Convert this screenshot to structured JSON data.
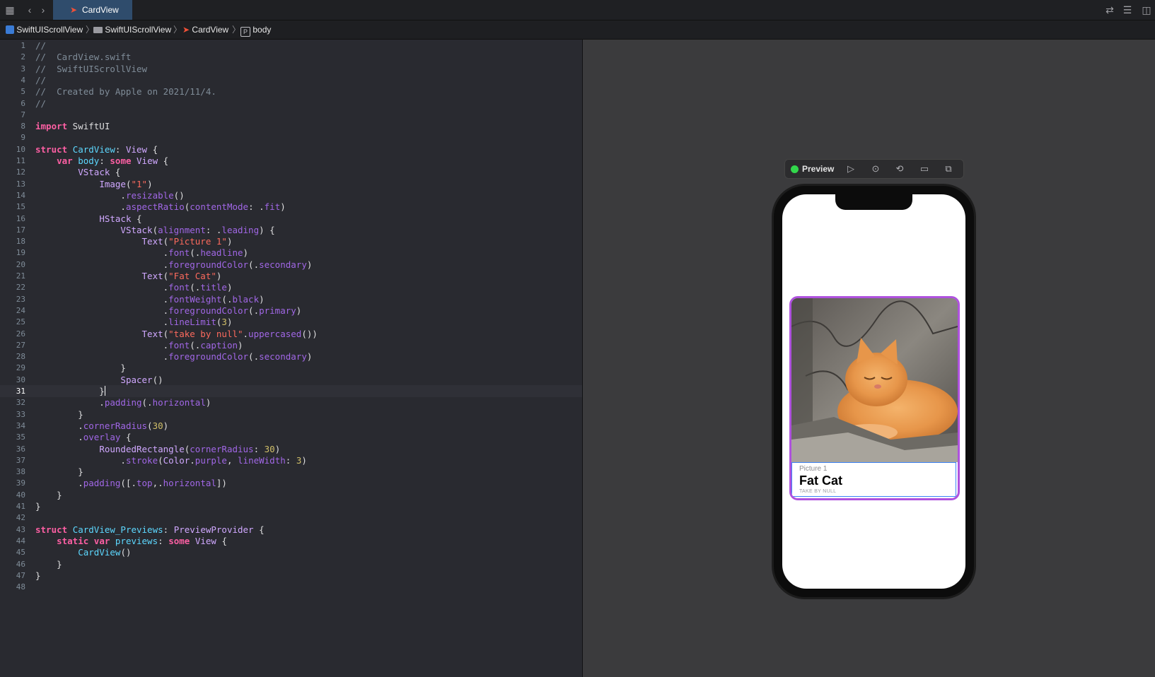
{
  "tab": {
    "title": "CardView"
  },
  "breadcrumb": {
    "project": "SwiftUIScrollView",
    "folder": "SwiftUIScrollView",
    "file": "CardView",
    "symbol": "body",
    "symbol_badge": "P"
  },
  "editor": {
    "current_line": 31,
    "lines": [
      {
        "n": "1",
        "t": [
          [
            "c-cmt",
            "//"
          ]
        ]
      },
      {
        "n": "2",
        "t": [
          [
            "c-cmt",
            "//  CardView.swift"
          ]
        ]
      },
      {
        "n": "3",
        "t": [
          [
            "c-cmt",
            "//  SwiftUIScrollView"
          ]
        ]
      },
      {
        "n": "4",
        "t": [
          [
            "c-cmt",
            "//"
          ]
        ]
      },
      {
        "n": "5",
        "t": [
          [
            "c-cmt",
            "//  Created by Apple on 2021/11/4."
          ]
        ]
      },
      {
        "n": "6",
        "t": [
          [
            "c-cmt",
            "//"
          ]
        ]
      },
      {
        "n": "7",
        "t": []
      },
      {
        "n": "8",
        "t": [
          [
            "c-kw",
            "import"
          ],
          [
            "c-plain",
            " SwiftUI"
          ]
        ]
      },
      {
        "n": "9",
        "t": []
      },
      {
        "n": "10",
        "t": [
          [
            "c-kw",
            "struct"
          ],
          [
            "c-plain",
            " "
          ],
          [
            "c-decl",
            "CardView"
          ],
          [
            "c-plain",
            ": "
          ],
          [
            "c-type",
            "View"
          ],
          [
            "c-plain",
            " {"
          ]
        ]
      },
      {
        "n": "11",
        "t": [
          [
            "c-plain",
            "    "
          ],
          [
            "c-kw",
            "var"
          ],
          [
            "c-plain",
            " "
          ],
          [
            "c-decl",
            "body"
          ],
          [
            "c-plain",
            ": "
          ],
          [
            "c-kw",
            "some"
          ],
          [
            "c-plain",
            " "
          ],
          [
            "c-type",
            "View"
          ],
          [
            "c-plain",
            " {"
          ]
        ]
      },
      {
        "n": "12",
        "t": [
          [
            "c-plain",
            "        "
          ],
          [
            "c-type",
            "VStack"
          ],
          [
            "c-plain",
            " {"
          ]
        ]
      },
      {
        "n": "13",
        "t": [
          [
            "c-plain",
            "            "
          ],
          [
            "c-type",
            "Image"
          ],
          [
            "c-plain",
            "("
          ],
          [
            "c-str",
            "\"1\""
          ],
          [
            "c-plain",
            ")"
          ]
        ]
      },
      {
        "n": "14",
        "t": [
          [
            "c-plain",
            "                ."
          ],
          [
            "c-call",
            "resizable"
          ],
          [
            "c-plain",
            "()"
          ]
        ]
      },
      {
        "n": "15",
        "t": [
          [
            "c-plain",
            "                ."
          ],
          [
            "c-call",
            "aspectRatio"
          ],
          [
            "c-plain",
            "("
          ],
          [
            "c-call",
            "contentMode"
          ],
          [
            "c-plain",
            ": ."
          ],
          [
            "c-mem",
            "fit"
          ],
          [
            "c-plain",
            ")"
          ]
        ]
      },
      {
        "n": "16",
        "t": [
          [
            "c-plain",
            "            "
          ],
          [
            "c-type",
            "HStack"
          ],
          [
            "c-plain",
            " {"
          ]
        ]
      },
      {
        "n": "17",
        "t": [
          [
            "c-plain",
            "                "
          ],
          [
            "c-type",
            "VStack"
          ],
          [
            "c-plain",
            "("
          ],
          [
            "c-call",
            "alignment"
          ],
          [
            "c-plain",
            ": ."
          ],
          [
            "c-mem",
            "leading"
          ],
          [
            "c-plain",
            ") {"
          ]
        ]
      },
      {
        "n": "18",
        "t": [
          [
            "c-plain",
            "                    "
          ],
          [
            "c-type",
            "Text"
          ],
          [
            "c-plain",
            "("
          ],
          [
            "c-str",
            "\"Picture 1\""
          ],
          [
            "c-plain",
            ")"
          ]
        ]
      },
      {
        "n": "19",
        "t": [
          [
            "c-plain",
            "                        ."
          ],
          [
            "c-call",
            "font"
          ],
          [
            "c-plain",
            "(."
          ],
          [
            "c-mem",
            "headline"
          ],
          [
            "c-plain",
            ")"
          ]
        ]
      },
      {
        "n": "20",
        "t": [
          [
            "c-plain",
            "                        ."
          ],
          [
            "c-call",
            "foregroundColor"
          ],
          [
            "c-plain",
            "(."
          ],
          [
            "c-mem",
            "secondary"
          ],
          [
            "c-plain",
            ")"
          ]
        ]
      },
      {
        "n": "21",
        "t": [
          [
            "c-plain",
            "                    "
          ],
          [
            "c-type",
            "Text"
          ],
          [
            "c-plain",
            "("
          ],
          [
            "c-str",
            "\"Fat Cat\""
          ],
          [
            "c-plain",
            ")"
          ]
        ]
      },
      {
        "n": "22",
        "t": [
          [
            "c-plain",
            "                        ."
          ],
          [
            "c-call",
            "font"
          ],
          [
            "c-plain",
            "(."
          ],
          [
            "c-mem",
            "title"
          ],
          [
            "c-plain",
            ")"
          ]
        ]
      },
      {
        "n": "23",
        "t": [
          [
            "c-plain",
            "                        ."
          ],
          [
            "c-call",
            "fontWeight"
          ],
          [
            "c-plain",
            "(."
          ],
          [
            "c-mem",
            "black"
          ],
          [
            "c-plain",
            ")"
          ]
        ]
      },
      {
        "n": "24",
        "t": [
          [
            "c-plain",
            "                        ."
          ],
          [
            "c-call",
            "foregroundColor"
          ],
          [
            "c-plain",
            "(."
          ],
          [
            "c-mem",
            "primary"
          ],
          [
            "c-plain",
            ")"
          ]
        ]
      },
      {
        "n": "25",
        "t": [
          [
            "c-plain",
            "                        ."
          ],
          [
            "c-call",
            "lineLimit"
          ],
          [
            "c-plain",
            "("
          ],
          [
            "c-num",
            "3"
          ],
          [
            "c-plain",
            ")"
          ]
        ]
      },
      {
        "n": "26",
        "t": [
          [
            "c-plain",
            "                    "
          ],
          [
            "c-type",
            "Text"
          ],
          [
            "c-plain",
            "("
          ],
          [
            "c-str",
            "\"take by null\""
          ],
          [
            "c-plain",
            "."
          ],
          [
            "c-call",
            "uppercased"
          ],
          [
            "c-plain",
            "())"
          ]
        ]
      },
      {
        "n": "27",
        "t": [
          [
            "c-plain",
            "                        ."
          ],
          [
            "c-call",
            "font"
          ],
          [
            "c-plain",
            "(."
          ],
          [
            "c-mem",
            "caption"
          ],
          [
            "c-plain",
            ")"
          ]
        ]
      },
      {
        "n": "28",
        "t": [
          [
            "c-plain",
            "                        ."
          ],
          [
            "c-call",
            "foregroundColor"
          ],
          [
            "c-plain",
            "(."
          ],
          [
            "c-mem",
            "secondary"
          ],
          [
            "c-plain",
            ")"
          ]
        ]
      },
      {
        "n": "29",
        "t": [
          [
            "c-plain",
            "                }"
          ]
        ]
      },
      {
        "n": "30",
        "t": [
          [
            "c-plain",
            "                "
          ],
          [
            "c-type",
            "Spacer"
          ],
          [
            "c-plain",
            "()"
          ]
        ]
      },
      {
        "n": "31",
        "t": [
          [
            "c-plain",
            "            }"
          ]
        ]
      },
      {
        "n": "32",
        "t": [
          [
            "c-plain",
            "            ."
          ],
          [
            "c-call",
            "padding"
          ],
          [
            "c-plain",
            "(."
          ],
          [
            "c-mem",
            "horizontal"
          ],
          [
            "c-plain",
            ")"
          ]
        ]
      },
      {
        "n": "33",
        "t": [
          [
            "c-plain",
            "        }"
          ]
        ]
      },
      {
        "n": "34",
        "t": [
          [
            "c-plain",
            "        ."
          ],
          [
            "c-call",
            "cornerRadius"
          ],
          [
            "c-plain",
            "("
          ],
          [
            "c-num",
            "30"
          ],
          [
            "c-plain",
            ")"
          ]
        ]
      },
      {
        "n": "35",
        "t": [
          [
            "c-plain",
            "        ."
          ],
          [
            "c-call",
            "overlay"
          ],
          [
            "c-plain",
            " {"
          ]
        ]
      },
      {
        "n": "36",
        "t": [
          [
            "c-plain",
            "            "
          ],
          [
            "c-type",
            "RoundedRectangle"
          ],
          [
            "c-plain",
            "("
          ],
          [
            "c-call",
            "cornerRadius"
          ],
          [
            "c-plain",
            ": "
          ],
          [
            "c-num",
            "30"
          ],
          [
            "c-plain",
            ")"
          ]
        ]
      },
      {
        "n": "37",
        "t": [
          [
            "c-plain",
            "                ."
          ],
          [
            "c-call",
            "stroke"
          ],
          [
            "c-plain",
            "("
          ],
          [
            "c-type",
            "Color"
          ],
          [
            "c-plain",
            "."
          ],
          [
            "c-mem",
            "purple"
          ],
          [
            "c-plain",
            ", "
          ],
          [
            "c-call",
            "lineWidth"
          ],
          [
            "c-plain",
            ": "
          ],
          [
            "c-num",
            "3"
          ],
          [
            "c-plain",
            ")"
          ]
        ]
      },
      {
        "n": "38",
        "t": [
          [
            "c-plain",
            "        }"
          ]
        ]
      },
      {
        "n": "39",
        "t": [
          [
            "c-plain",
            "        ."
          ],
          [
            "c-call",
            "padding"
          ],
          [
            "c-plain",
            "([."
          ],
          [
            "c-mem",
            "top"
          ],
          [
            "c-plain",
            ",."
          ],
          [
            "c-mem",
            "horizontal"
          ],
          [
            "c-plain",
            "])"
          ]
        ]
      },
      {
        "n": "40",
        "t": [
          [
            "c-plain",
            "    }"
          ]
        ]
      },
      {
        "n": "41",
        "t": [
          [
            "c-plain",
            "}"
          ]
        ]
      },
      {
        "n": "42",
        "t": []
      },
      {
        "n": "43",
        "t": [
          [
            "c-kw",
            "struct"
          ],
          [
            "c-plain",
            " "
          ],
          [
            "c-decl",
            "CardView_Previews"
          ],
          [
            "c-plain",
            ": "
          ],
          [
            "c-type",
            "PreviewProvider"
          ],
          [
            "c-plain",
            " {"
          ]
        ]
      },
      {
        "n": "44",
        "t": [
          [
            "c-plain",
            "    "
          ],
          [
            "c-kw",
            "static"
          ],
          [
            "c-plain",
            " "
          ],
          [
            "c-kw",
            "var"
          ],
          [
            "c-plain",
            " "
          ],
          [
            "c-decl",
            "previews"
          ],
          [
            "c-plain",
            ": "
          ],
          [
            "c-kw",
            "some"
          ],
          [
            "c-plain",
            " "
          ],
          [
            "c-type",
            "View"
          ],
          [
            "c-plain",
            " {"
          ]
        ]
      },
      {
        "n": "45",
        "t": [
          [
            "c-plain",
            "        "
          ],
          [
            "c-decl",
            "CardView"
          ],
          [
            "c-plain",
            "()"
          ]
        ]
      },
      {
        "n": "46",
        "t": [
          [
            "c-plain",
            "    }"
          ]
        ]
      },
      {
        "n": "47",
        "t": [
          [
            "c-plain",
            "}"
          ]
        ]
      },
      {
        "n": "48",
        "t": []
      }
    ]
  },
  "preview": {
    "label": "Preview",
    "status_color": "#32d74b",
    "card": {
      "subtitle": "Picture 1",
      "title": "Fat Cat",
      "caption": "TAKE BY NULL",
      "stroke_color": "#af52de"
    }
  }
}
